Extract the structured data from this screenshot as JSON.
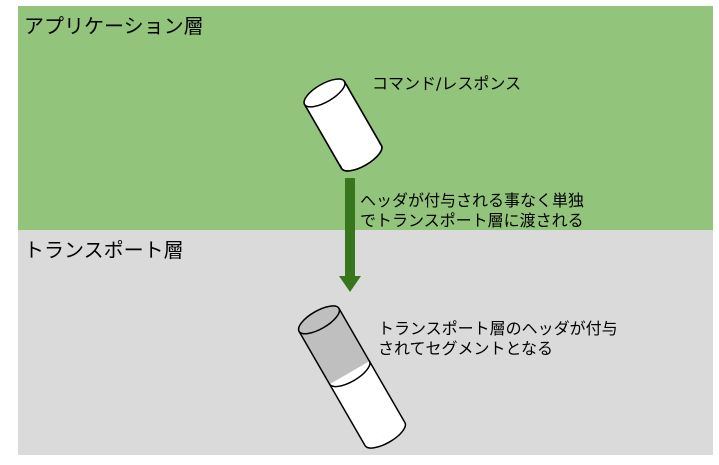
{
  "layers": {
    "application": {
      "title": "アプリケーション層"
    },
    "transport": {
      "title": "トランスポート層"
    }
  },
  "labels": {
    "command_response": "コマンド/レスポンス",
    "arrow_line1": "ヘッダが付与される事なく単独",
    "arrow_line2": "でトランスポート層に渡される",
    "segment_line1": "トランスポート層のヘッダが付与",
    "segment_line2": "されてセグメントとなる"
  },
  "colors": {
    "application_layer": "#92c47c",
    "transport_layer": "#dadada",
    "arrow": "#38761d",
    "header_part": "#bfbfbf"
  }
}
